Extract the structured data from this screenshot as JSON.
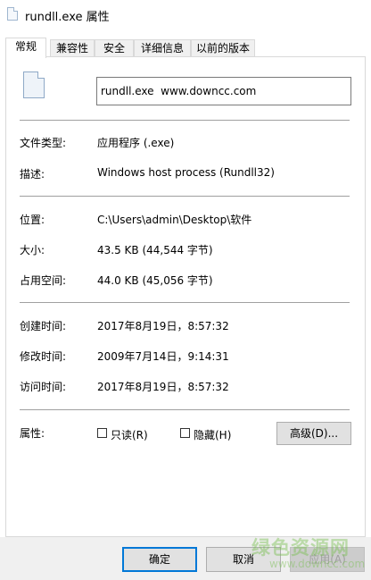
{
  "window": {
    "title": "rundll.exe 属性"
  },
  "tabs": [
    {
      "label": "常规",
      "active": true
    },
    {
      "label": "兼容性"
    },
    {
      "label": "安全"
    },
    {
      "label": "详细信息"
    },
    {
      "label": "以前的版本"
    }
  ],
  "general": {
    "file_name": "rundll.exe  www.downcc.com",
    "rows": [
      {
        "label": "文件类型:",
        "value": "应用程序 (.exe)"
      },
      {
        "label": "描述:",
        "value": "Windows host process (Rundll32)"
      },
      {
        "label": "位置:",
        "value": "C:\\Users\\admin\\Desktop\\软件"
      },
      {
        "label": "大小:",
        "value": "43.5 KB (44,544 字节)"
      },
      {
        "label": "占用空间:",
        "value": "44.0 KB (45,056 字节)"
      },
      {
        "label": "创建时间:",
        "value": "2017年8月19日，8:57:32"
      },
      {
        "label": "修改时间:",
        "value": "2009年7月14日，9:14:31"
      },
      {
        "label": "访问时间:",
        "value": "2017年8月19日，8:57:32"
      }
    ],
    "attributes": {
      "label": "属性:",
      "readonly_label": "只读(R)",
      "hidden_label": "隐藏(H)",
      "advanced_button": "高级(D)..."
    }
  },
  "footer": {
    "ok": "确定",
    "cancel": "取消",
    "apply": "应用(A)"
  },
  "watermark": {
    "text": "绿色资源网",
    "url": "www.downcc.com"
  },
  "icons": {
    "title": "file-icon",
    "file": "file-icon"
  }
}
